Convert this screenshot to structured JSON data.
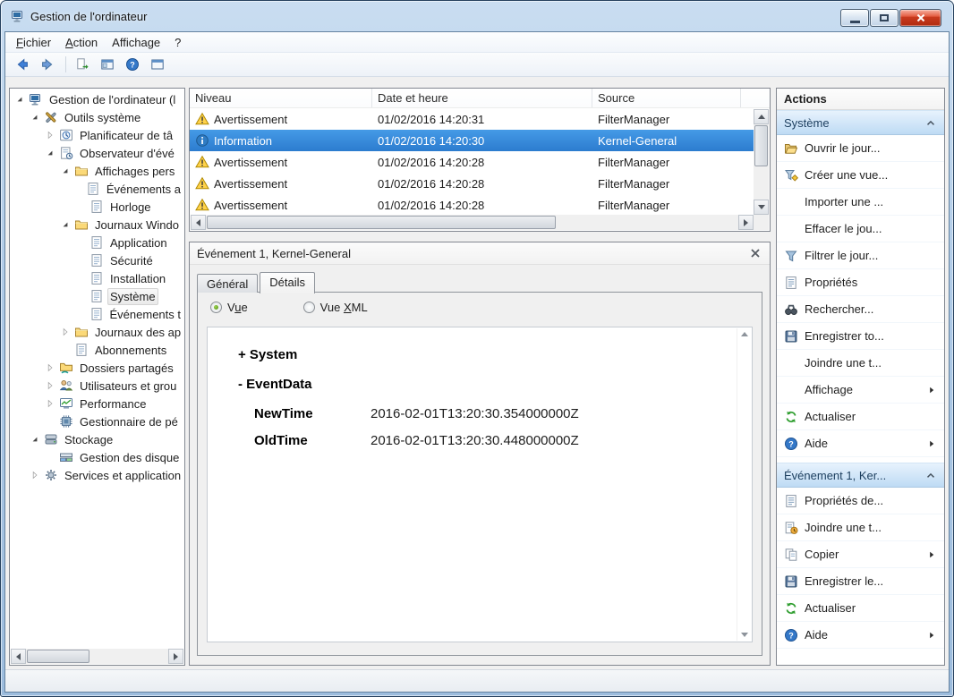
{
  "colors": {
    "selection_blue": "#3389dd",
    "titlebar_glass_blue": "#adc9e6",
    "close_button_red": "#c83a1e",
    "warning_yellow": "#ffd24a",
    "info_blue": "#2f7cc4",
    "actions_header_blue": "#bedbf4",
    "panel_border_gray": "#828790"
  },
  "window": {
    "title": "Gestion de l'ordinateur",
    "controls": [
      {
        "name": "minimize"
      },
      {
        "name": "maximize"
      },
      {
        "name": "close"
      }
    ]
  },
  "menu": {
    "items": [
      {
        "label": "Fichier",
        "accel": 0
      },
      {
        "label": "Action",
        "accel": 0
      },
      {
        "label": "Affichage",
        "accel": 7
      },
      {
        "label": "?",
        "accel": -1
      }
    ]
  },
  "toolbar": {
    "buttons": [
      {
        "name": "back",
        "icon": "arrow-left"
      },
      {
        "name": "forward",
        "icon": "arrow-right"
      },
      {
        "name": "export-list",
        "icon": "doc-export"
      },
      {
        "name": "show-console-tree",
        "icon": "window-tree"
      },
      {
        "name": "help",
        "icon": "help"
      },
      {
        "name": "properties-window",
        "icon": "window"
      }
    ]
  },
  "tree": {
    "items": [
      {
        "label": "Gestion de l'ordinateur (l",
        "level": 0,
        "state": "expanded",
        "icon": "computer",
        "selected": false
      },
      {
        "label": "Outils système",
        "level": 1,
        "state": "expanded",
        "icon": "tools",
        "selected": false
      },
      {
        "label": "Planificateur de tâ",
        "level": 2,
        "state": "collapsed",
        "icon": "scheduler",
        "selected": false
      },
      {
        "label": "Observateur d'évé",
        "level": 2,
        "state": "expanded",
        "icon": "eventvwr",
        "selected": false
      },
      {
        "label": "Affichages pers",
        "level": 3,
        "state": "expanded",
        "icon": "folder",
        "selected": false
      },
      {
        "label": "Événements a",
        "level": 4,
        "state": "leaf",
        "icon": "log",
        "selected": false
      },
      {
        "label": "Horloge",
        "level": 4,
        "state": "leaf",
        "icon": "log",
        "selected": false
      },
      {
        "label": "Journaux Windo",
        "level": 3,
        "state": "expanded",
        "icon": "folder",
        "selected": false
      },
      {
        "label": "Application",
        "level": 4,
        "state": "leaf",
        "icon": "log",
        "selected": false
      },
      {
        "label": "Sécurité",
        "level": 4,
        "state": "leaf",
        "icon": "log",
        "selected": false
      },
      {
        "label": "Installation",
        "level": 4,
        "state": "leaf",
        "icon": "log",
        "selected": false
      },
      {
        "label": "Système",
        "level": 4,
        "state": "leaf",
        "icon": "log",
        "selected": true
      },
      {
        "label": "Événements t",
        "level": 4,
        "state": "leaf",
        "icon": "log",
        "selected": false
      },
      {
        "label": "Journaux des ap",
        "level": 3,
        "state": "collapsed",
        "icon": "folder",
        "selected": false
      },
      {
        "label": "Abonnements",
        "level": 3,
        "state": "leaf",
        "icon": "log",
        "selected": false
      },
      {
        "label": "Dossiers partagés",
        "level": 2,
        "state": "collapsed",
        "icon": "shared-folder",
        "selected": false
      },
      {
        "label": "Utilisateurs et grou",
        "level": 2,
        "state": "collapsed",
        "icon": "users",
        "selected": false
      },
      {
        "label": "Performance",
        "level": 2,
        "state": "collapsed",
        "icon": "performance",
        "selected": false
      },
      {
        "label": "Gestionnaire de pé",
        "level": 2,
        "state": "leaf",
        "icon": "devmgr",
        "selected": false
      },
      {
        "label": "Stockage",
        "level": 1,
        "state": "expanded",
        "icon": "storage",
        "selected": false
      },
      {
        "label": "Gestion des disque",
        "level": 2,
        "state": "leaf",
        "icon": "diskmgmt",
        "selected": false
      },
      {
        "label": "Services et application",
        "level": 1,
        "state": "collapsed",
        "icon": "services",
        "selected": false
      }
    ]
  },
  "events": {
    "columns": [
      "Niveau",
      "Date et heure",
      "Source"
    ],
    "rows": [
      {
        "icon": "warning",
        "level": "Avertissement",
        "date": "01/02/2016 14:20:31",
        "source": "FilterManager",
        "selected": false
      },
      {
        "icon": "info",
        "level": "Information",
        "date": "01/02/2016 14:20:30",
        "source": "Kernel-General",
        "selected": true
      },
      {
        "icon": "warning",
        "level": "Avertissement",
        "date": "01/02/2016 14:20:28",
        "source": "FilterManager",
        "selected": false
      },
      {
        "icon": "warning",
        "level": "Avertissement",
        "date": "01/02/2016 14:20:28",
        "source": "FilterManager",
        "selected": false
      },
      {
        "icon": "warning",
        "level": "Avertissement",
        "date": "01/02/2016 14:20:28",
        "source": "FilterManager",
        "selected": false
      }
    ]
  },
  "detail": {
    "title": "Événement 1, Kernel-General",
    "tabs": [
      {
        "label": "Général",
        "active": false
      },
      {
        "label": "Détails",
        "active": true
      }
    ],
    "radios": [
      {
        "label": "Vue",
        "accel": 1,
        "checked": true
      },
      {
        "label": "Vue XML",
        "accel": 4,
        "checked": false
      }
    ],
    "content": [
      {
        "type": "node",
        "text": "+ System"
      },
      {
        "type": "node",
        "text": "- EventData"
      },
      {
        "type": "kv",
        "key": "NewTime",
        "value": "2016-02-01T13:20:30.354000000Z"
      },
      {
        "type": "kv",
        "key": "OldTime",
        "value": "2016-02-01T13:20:30.448000000Z"
      }
    ]
  },
  "actions": {
    "title": "Actions",
    "sections": [
      {
        "header": "Système",
        "items": [
          {
            "label": "Ouvrir le jour...",
            "icon": "open-folder",
            "submenu": false
          },
          {
            "label": "Créer une vue...",
            "icon": "create-view",
            "submenu": false
          },
          {
            "label": "Importer une ...",
            "icon": "",
            "submenu": false
          },
          {
            "label": "Effacer le jou...",
            "icon": "",
            "submenu": false
          },
          {
            "label": "Filtrer le jour...",
            "icon": "filter",
            "submenu": false
          },
          {
            "label": "Propriétés",
            "icon": "properties",
            "submenu": false
          },
          {
            "label": "Rechercher...",
            "icon": "find",
            "submenu": false
          },
          {
            "label": "Enregistrer to...",
            "icon": "save",
            "submenu": false
          },
          {
            "label": "Joindre une t...",
            "icon": "",
            "submenu": false
          },
          {
            "label": "Affichage",
            "icon": "",
            "submenu": true
          },
          {
            "label": "Actualiser",
            "icon": "refresh",
            "submenu": false
          },
          {
            "label": "Aide",
            "icon": "help",
            "submenu": true
          }
        ]
      },
      {
        "header": "Événement 1, Ker...",
        "items": [
          {
            "label": "Propriétés de...",
            "icon": "properties",
            "submenu": false
          },
          {
            "label": "Joindre une t...",
            "icon": "attach-task",
            "submenu": false
          },
          {
            "label": "Copier",
            "icon": "copy",
            "submenu": true
          },
          {
            "label": "Enregistrer le...",
            "icon": "save",
            "submenu": false
          },
          {
            "label": "Actualiser",
            "icon": "refresh",
            "submenu": false
          },
          {
            "label": "Aide",
            "icon": "help",
            "submenu": true
          }
        ]
      }
    ]
  }
}
